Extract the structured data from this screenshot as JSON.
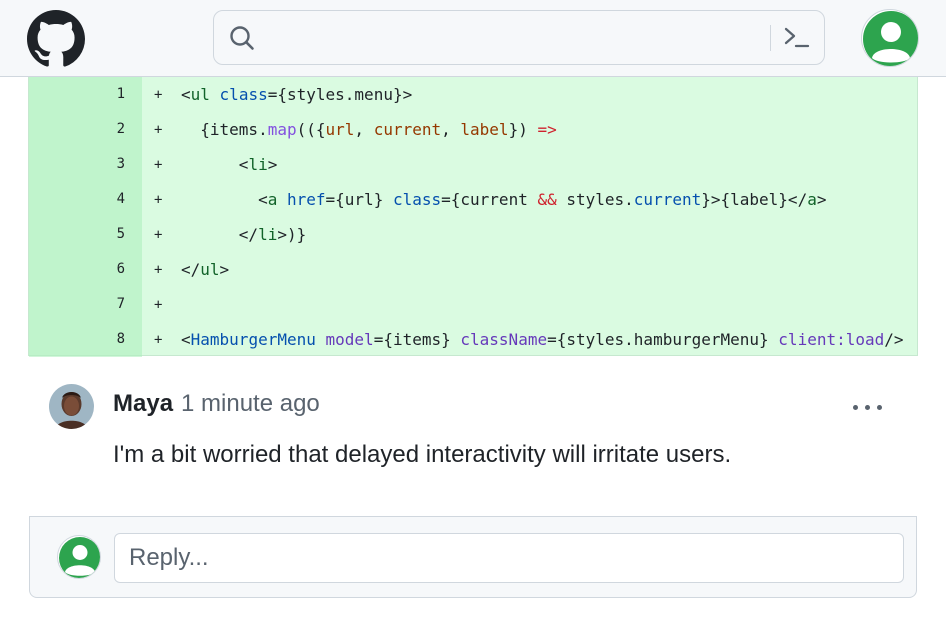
{
  "header": {
    "logo_icon": "github-octocat-icon",
    "search": {
      "icon": "search-icon",
      "placeholder": "",
      "command_icon": "terminal-icon"
    },
    "user_avatar_icon": "default-user-avatar-icon"
  },
  "diff": {
    "marker": "+",
    "lines": [
      {
        "number": "1"
      },
      {
        "number": "2"
      },
      {
        "number": "3"
      },
      {
        "number": "4"
      },
      {
        "number": "5"
      },
      {
        "number": "6"
      },
      {
        "number": "7"
      },
      {
        "number": "8"
      }
    ],
    "tokens": {
      "l1": [
        "<",
        "ul",
        " ",
        "class",
        "=",
        "{styles.menu}>"
      ],
      "l2": [
        "  {items.",
        "map",
        "(({",
        "url",
        ", ",
        "current",
        ", ",
        "label",
        "}) ",
        "=>"
      ],
      "l3": [
        "      <",
        "li",
        ">"
      ],
      "l4": [
        "        <",
        "a",
        " ",
        "href",
        "=",
        "{url} ",
        "class",
        "=",
        "{current ",
        "&&",
        " styles.",
        "current",
        "}>{label}</",
        "a",
        ">"
      ],
      "l5": [
        "      </",
        "li",
        ">)}"
      ],
      "l6": [
        "</",
        "ul",
        ">"
      ],
      "l7": [
        ""
      ],
      "l8": [
        "<",
        "HamburgerMenu",
        " ",
        "model",
        "=",
        "{items} ",
        "className",
        "=",
        "{styles.hamburgerMenu} ",
        "client",
        ":",
        "load",
        "/>"
      ]
    }
  },
  "comment": {
    "author": "Maya",
    "time": "1 minute ago",
    "body": "I'm a bit worried that delayed interactivity will irritate users.",
    "more_icon": "more-horizontal-icon"
  },
  "reply": {
    "placeholder": "Reply..."
  },
  "colors": {
    "header_bg": "#f6f8fa",
    "diff_add_bg": "#dafbe1",
    "diff_gutter_bg": "#aceebb",
    "avatar_green": "#2da44e"
  }
}
